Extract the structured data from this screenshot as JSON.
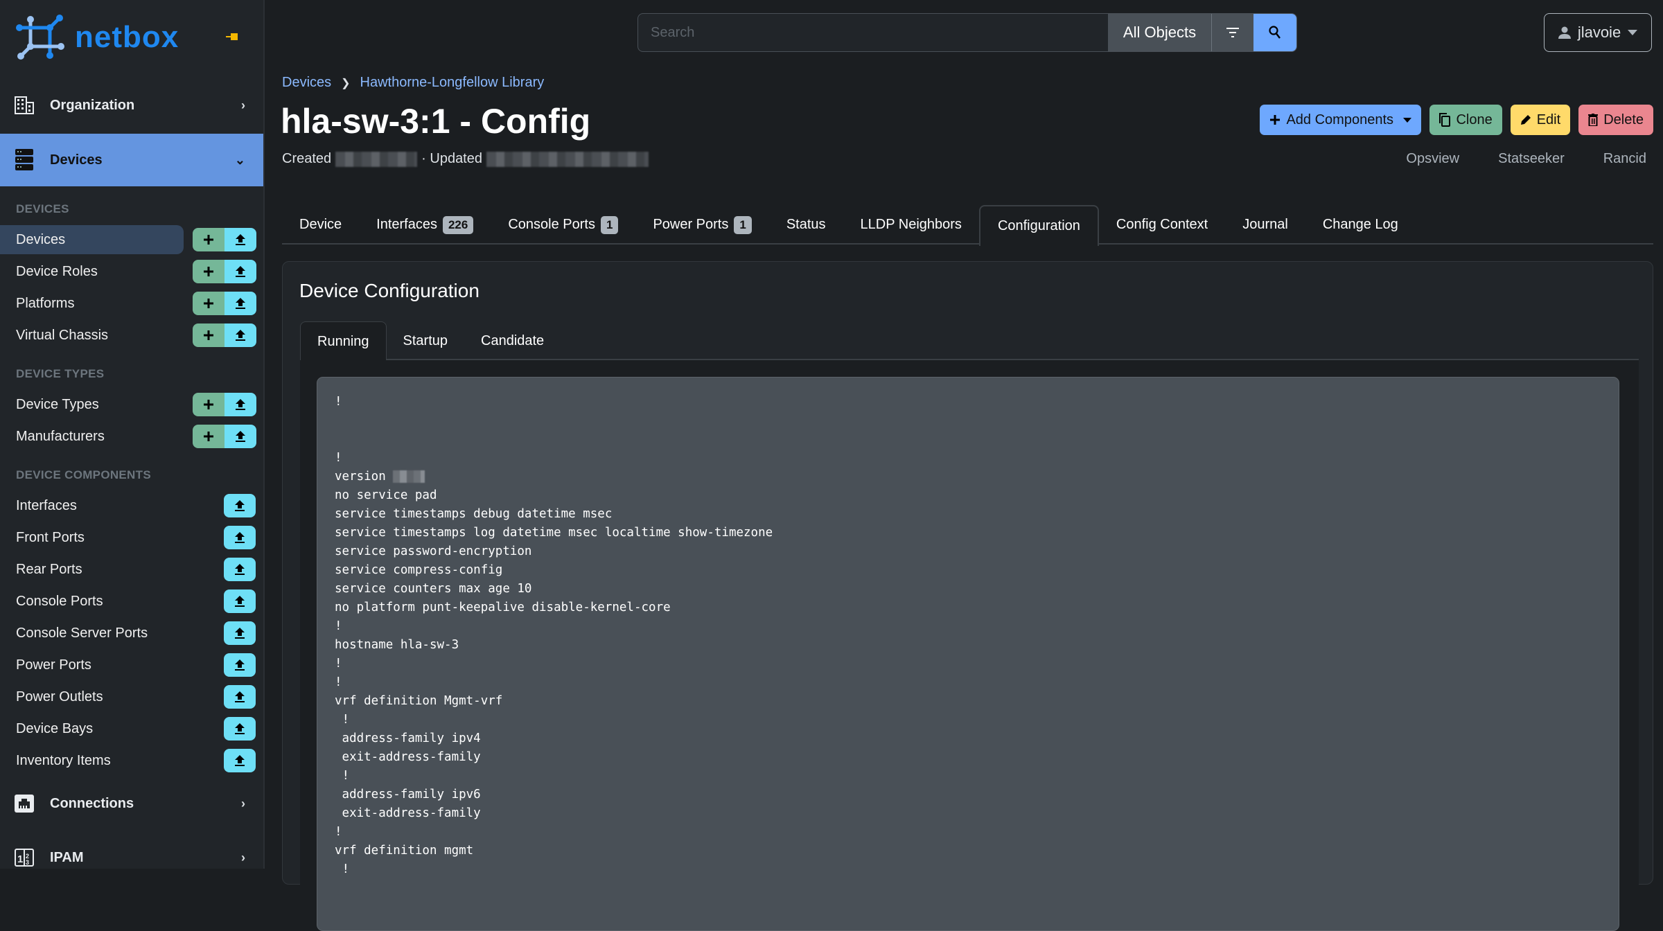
{
  "brand": {
    "name": "netbox",
    "logo_color": "#1f88f0"
  },
  "sidebar": {
    "menus_top": [
      {
        "label": "Organization",
        "icon": "building-icon"
      },
      {
        "label": "Devices",
        "icon": "server-icon",
        "expanded": true
      }
    ],
    "sections": [
      {
        "title": "DEVICES",
        "items": [
          {
            "label": "Devices",
            "selected": true,
            "add": true,
            "import": true
          },
          {
            "label": "Device Roles",
            "add": true,
            "import": true
          },
          {
            "label": "Platforms",
            "add": true,
            "import": true
          },
          {
            "label": "Virtual Chassis",
            "add": true,
            "import": true
          }
        ]
      },
      {
        "title": "DEVICE TYPES",
        "items": [
          {
            "label": "Device Types",
            "add": true,
            "import": true
          },
          {
            "label": "Manufacturers",
            "add": true,
            "import": true
          }
        ]
      },
      {
        "title": "DEVICE COMPONENTS",
        "items": [
          {
            "label": "Interfaces",
            "import": true
          },
          {
            "label": "Front Ports",
            "import": true
          },
          {
            "label": "Rear Ports",
            "import": true
          },
          {
            "label": "Console Ports",
            "import": true
          },
          {
            "label": "Console Server Ports",
            "import": true
          },
          {
            "label": "Power Ports",
            "import": true
          },
          {
            "label": "Power Outlets",
            "import": true
          },
          {
            "label": "Device Bays",
            "import": true
          },
          {
            "label": "Inventory Items",
            "import": true
          }
        ]
      }
    ],
    "menus_bottom": [
      {
        "label": "Connections",
        "icon": "ethernet-icon"
      },
      {
        "label": "IPAM",
        "icon": "numeric-icon"
      }
    ]
  },
  "search": {
    "placeholder": "Search",
    "value": "",
    "scope": "All Objects"
  },
  "user": {
    "name": "jlavoie"
  },
  "breadcrumb": [
    "Devices",
    "Hawthorne-Longfellow Library"
  ],
  "page": {
    "title": "hla-sw-3:1 - Config",
    "created_label": "Created",
    "updated_label": "· Updated"
  },
  "actions": {
    "add_components": "Add Components",
    "clone": "Clone",
    "edit": "Edit",
    "delete": "Delete"
  },
  "links": [
    "Opsview",
    "Statseeker",
    "Rancid"
  ],
  "tabs": [
    {
      "label": "Device"
    },
    {
      "label": "Interfaces",
      "badge": "226"
    },
    {
      "label": "Console Ports",
      "badge": "1"
    },
    {
      "label": "Power Ports",
      "badge": "1"
    },
    {
      "label": "Status"
    },
    {
      "label": "LLDP Neighbors"
    },
    {
      "label": "Configuration",
      "active": true
    },
    {
      "label": "Config Context"
    },
    {
      "label": "Journal"
    },
    {
      "label": "Change Log"
    }
  ],
  "card": {
    "title": "Device Configuration",
    "subtabs": [
      {
        "label": "Running",
        "active": true
      },
      {
        "label": "Startup"
      },
      {
        "label": "Candidate"
      }
    ],
    "config_lines": [
      "!",
      "",
      "",
      "!",
      "version [redacted]",
      "no service pad",
      "service timestamps debug datetime msec",
      "service timestamps log datetime msec localtime show-timezone",
      "service password-encryption",
      "service compress-config",
      "service counters max age 10",
      "no platform punt-keepalive disable-kernel-core",
      "!",
      "hostname hla-sw-3",
      "!",
      "!",
      "vrf definition Mgmt-vrf",
      " !",
      " address-family ipv4",
      " exit-address-family",
      " !",
      " address-family ipv6",
      " exit-address-family",
      "!",
      "vrf definition mgmt",
      " !"
    ]
  },
  "colors": {
    "accent": "#6ea8fe",
    "selected_menu": "#6495e0",
    "add_green": "#75b798",
    "import_cyan": "#6edff6",
    "edit_yellow": "#ffda6a",
    "delete_red": "#ea868f"
  }
}
